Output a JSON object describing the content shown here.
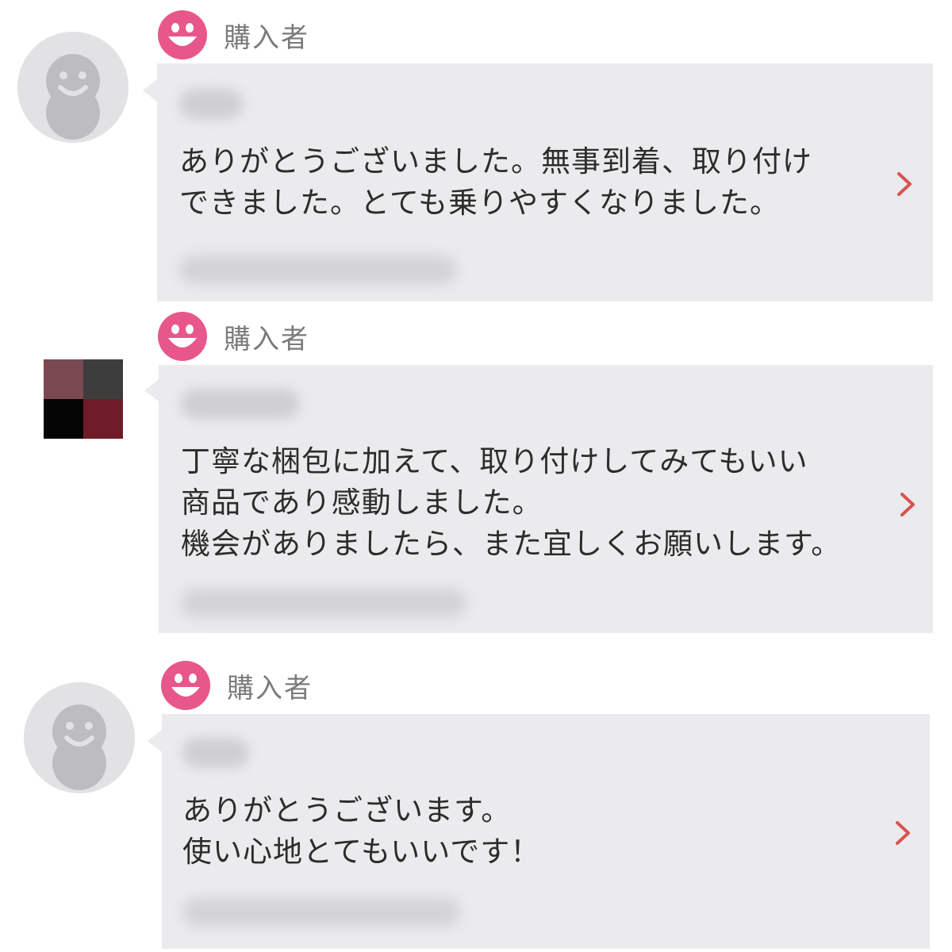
{
  "accent_color": "#e8578a",
  "chevron_color": "#d9534f",
  "reviews": [
    {
      "role": "購入者",
      "avatar": "default-person-icon",
      "reviewer_name": "",
      "text": "ありがとうございました。無事到着、取り付け\nできました。とても乗りやすくなりました。",
      "date": ""
    },
    {
      "role": "購入者",
      "avatar": "mosaic-image",
      "reviewer_name": "",
      "text": "丁寧な梱包に加えて、取り付けしてみてもいい\n商品であり感動しました。\n機会がありましたら、また宜しくお願いします。",
      "date": ""
    },
    {
      "role": "購入者",
      "avatar": "default-person-icon",
      "reviewer_name": "",
      "text": "ありがとうございます。\n使い心地とてもいいです！",
      "date": ""
    }
  ]
}
